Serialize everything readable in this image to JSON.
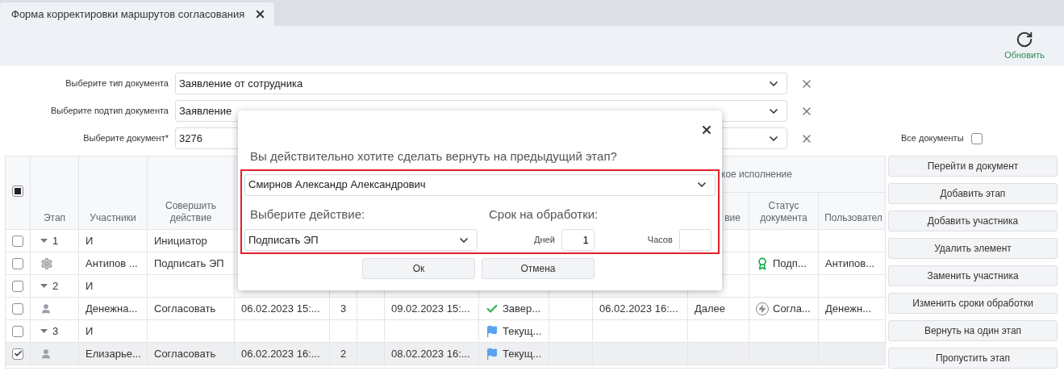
{
  "tab": {
    "title": "Форма корректировки маршрутов согласования",
    "selected": true
  },
  "toolbar": {
    "refresh": "Обновить"
  },
  "filters": [
    {
      "label": "Выберите тип документа",
      "value": "Заявление от сотрудника"
    },
    {
      "label": "Выберите подтип документа",
      "value": "Заявление"
    },
    {
      "label": "Выберите документ*",
      "value": "3276"
    }
  ],
  "all_documents": {
    "label": "Все документы",
    "checked": false
  },
  "table": {
    "select_all": {
      "indeterminate": true
    },
    "group_header": "кое исполнение",
    "header": {
      "stage": "Этап",
      "participants": "Участники",
      "action": "Совершить действие",
      "column_11": "вие",
      "document_status": "Статус документа",
      "user": "Пользовател"
    },
    "rows": [
      {
        "kind": "group",
        "checked": false,
        "selected": false,
        "stage": "1",
        "participants": "И",
        "action": "Инициатор"
      },
      {
        "kind": "system",
        "checked": false,
        "selected": false,
        "participants": "Антипов ...",
        "action": "Подписать ЭП",
        "document_status": {
          "kind": "signed",
          "text": "Подп..."
        },
        "user": "Антипов..."
      },
      {
        "kind": "group",
        "checked": false,
        "selected": false,
        "stage": "2",
        "participants": "И"
      },
      {
        "kind": "person",
        "checked": false,
        "selected": false,
        "participants": "Денежна...",
        "action": "Согласовать",
        "column_4": "06.02.2023 15:...",
        "column_5": "3",
        "column_7": "09.02.2023 15:...",
        "column_8": {
          "kind": "done",
          "text": "Завер..."
        },
        "column_10": "06.02.2023 16:...",
        "column_11": "Далее",
        "document_status": {
          "kind": "approval",
          "text": "Согла..."
        },
        "user": "Денежн..."
      },
      {
        "kind": "group",
        "checked": false,
        "selected": false,
        "stage": "3",
        "participants": "И",
        "column_8": {
          "kind": "current",
          "text": "Текущ..."
        }
      },
      {
        "kind": "person",
        "checked": true,
        "selected": true,
        "participants": "Елизарье...",
        "action": "Согласовать",
        "column_4": "06.02.2023 16:...",
        "column_5": "2",
        "column_7": "08.02.2023 16:...",
        "column_8": {
          "kind": "current",
          "text": "Текущ..."
        }
      }
    ]
  },
  "actions": [
    "Перейти в документ",
    "Добавить этап",
    "Добавить участника",
    "Удалить элемент",
    "Заменить участника",
    "Изменить сроки обработки",
    "Вернуть на один этап",
    "Пропустить этап"
  ],
  "dialog": {
    "question": "Вы действительно хотите сделать вернуть на предыдущий этап?",
    "highlighted": true,
    "assignee": "Смирнов Александр Александрович",
    "action_label": "Выберите действие:",
    "action_value": "Подписать ЭП",
    "deadline_label": "Срок на обработки:",
    "days_label": "Дней",
    "days_value": "1",
    "hours_label": "Часов",
    "buttons": [
      "Ок",
      "Отмена"
    ]
  }
}
